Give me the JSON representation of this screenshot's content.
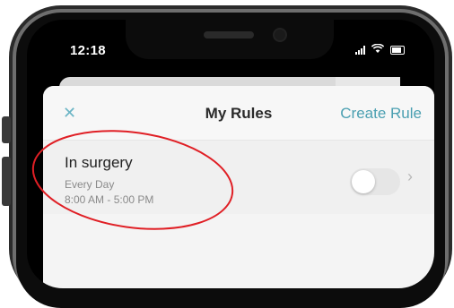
{
  "status_bar": {
    "time": "12:18"
  },
  "header": {
    "close_icon": "close-icon",
    "title": "My Rules",
    "create_label": "Create Rule"
  },
  "rules": [
    {
      "name": "In surgery",
      "days": "Every Day",
      "time": "8:00 AM - 5:00 PM",
      "enabled": false
    }
  ],
  "colors": {
    "accent": "#4a9fb1",
    "annotation": "#e01f25",
    "background": "#f4f4f4"
  }
}
